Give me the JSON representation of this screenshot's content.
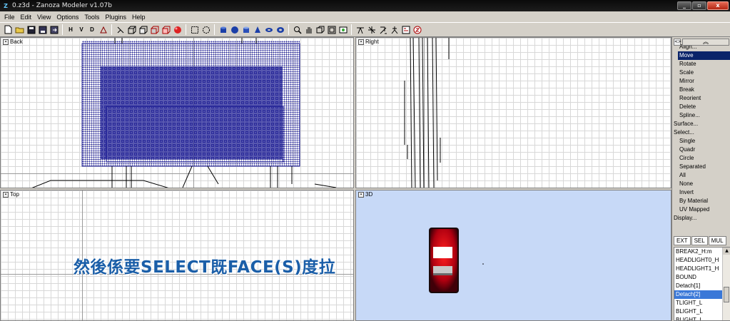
{
  "window": {
    "title": "0.z3d - Zanoza Modeler v1.07b",
    "controls": [
      "_",
      "▫",
      "x"
    ]
  },
  "menu": [
    "File",
    "Edit",
    "View",
    "Options",
    "Tools",
    "Plugins",
    "Help"
  ],
  "toolbar": {
    "view_letters": [
      "H",
      "V",
      "D"
    ]
  },
  "viewports": {
    "back": "Back",
    "right": "Right",
    "top": "Top",
    "three_d": "3D"
  },
  "command_panel": {
    "toggle_label": "<>",
    "items": [
      {
        "label": "Align...",
        "type": "sub"
      },
      {
        "label": "Move",
        "type": "selected"
      },
      {
        "label": "Rotate",
        "type": "sub"
      },
      {
        "label": "Scale",
        "type": "sub"
      },
      {
        "label": "Mirror",
        "type": "sub"
      },
      {
        "label": "Break",
        "type": "sub"
      },
      {
        "label": "Reorient",
        "type": "sub"
      },
      {
        "label": "Delete",
        "type": "sub"
      },
      {
        "label": "Spline...",
        "type": "sub"
      },
      {
        "label": "Surface...",
        "type": "header"
      },
      {
        "label": "Select...",
        "type": "header"
      },
      {
        "label": "Single",
        "type": "sub"
      },
      {
        "label": "Quadr",
        "type": "sub"
      },
      {
        "label": "Circle",
        "type": "sub"
      },
      {
        "label": "Separated",
        "type": "sub"
      },
      {
        "label": "All",
        "type": "sub"
      },
      {
        "label": "None",
        "type": "sub"
      },
      {
        "label": "Invert",
        "type": "sub"
      },
      {
        "label": "By Material",
        "type": "sub"
      },
      {
        "label": "UV Mapped",
        "type": "sub"
      },
      {
        "label": "Display...",
        "type": "header"
      }
    ],
    "tabs": [
      "EXT",
      "SEL",
      "MUL"
    ],
    "objects": [
      {
        "label": "BREAK2_H:m",
        "selected": false
      },
      {
        "label": "HEADLIGHT0_H",
        "selected": false
      },
      {
        "label": "HEADLIGHT1_H",
        "selected": false
      },
      {
        "label": "BOUND",
        "selected": false
      },
      {
        "label": "Detach[1]",
        "selected": false
      },
      {
        "label": "Detach[2]",
        "selected": true
      },
      {
        "label": "TLIGHT_L",
        "selected": false
      },
      {
        "label": "BLIGHT_L",
        "selected": false
      },
      {
        "label": "BLIGHT_L",
        "selected": false
      }
    ]
  },
  "caption": "然後係要SELECT既FACE(S)度拉",
  "colors": {
    "selection": "#0a246a",
    "caption": "#1a5ea8",
    "viewport_3d_bg": "#c7d9f7"
  }
}
